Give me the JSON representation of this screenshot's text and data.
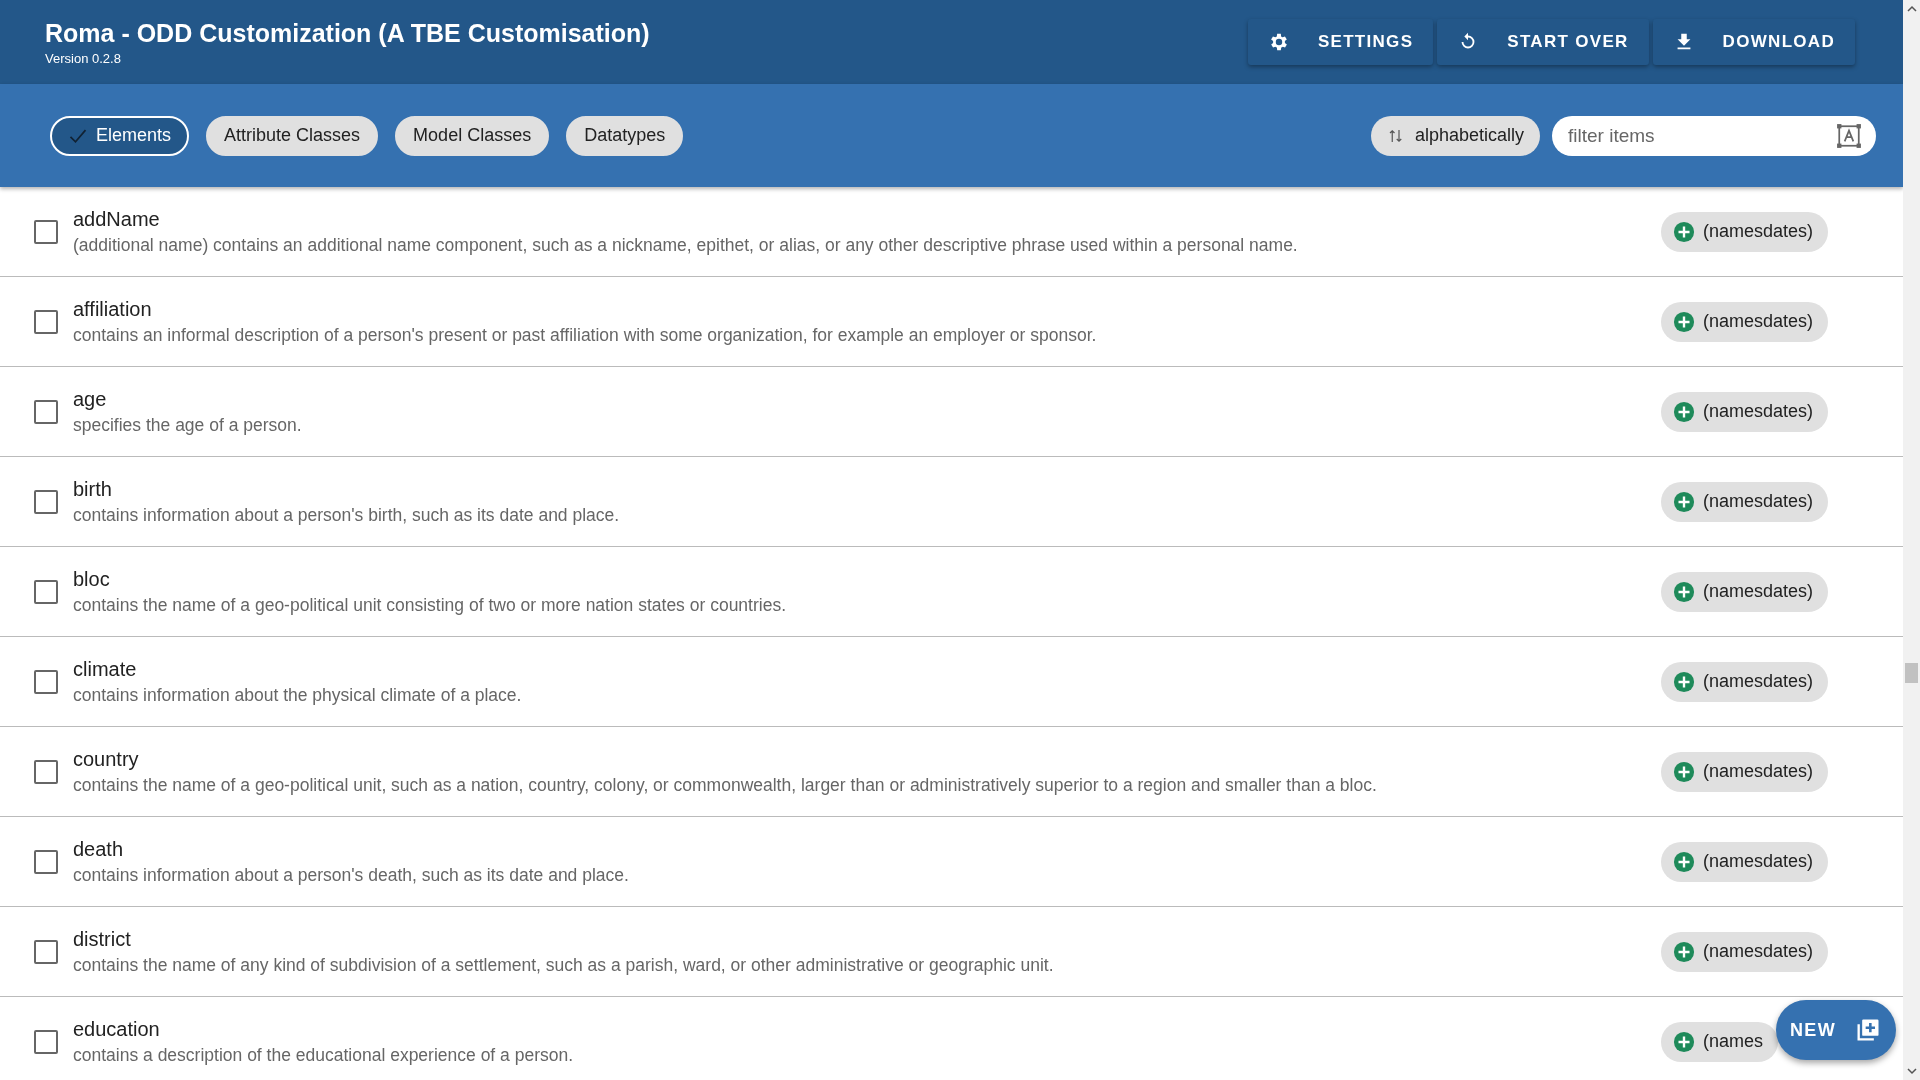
{
  "header": {
    "title": "Roma - ODD Customization (A TBE Customisation)",
    "version": "Version 0.2.8",
    "actions": [
      {
        "kind": "settings",
        "label": "SETTINGS"
      },
      {
        "kind": "reset",
        "label": "START OVER"
      },
      {
        "kind": "download",
        "label": "DOWNLOAD"
      }
    ]
  },
  "filters": [
    {
      "label": "Elements",
      "selected": true
    },
    {
      "label": "Attribute Classes",
      "selected": false
    },
    {
      "label": "Model Classes",
      "selected": false
    },
    {
      "label": "Datatypes",
      "selected": false
    }
  ],
  "sort": {
    "label": "alphabetically"
  },
  "search": {
    "placeholder": "filter items"
  },
  "items": [
    {
      "name": "addName",
      "description": "(additional name) contains an additional name component, such as a nickname, epithet, or alias, or any other descriptive phrase used within a personal name.",
      "checked": false,
      "module": "(namesdates)"
    },
    {
      "name": "affiliation",
      "description": "contains an informal description of a person's present or past affiliation with some organization, for example an employer or sponsor.",
      "checked": false,
      "module": "(namesdates)"
    },
    {
      "name": "age",
      "description": "specifies the age of a person.",
      "checked": false,
      "module": "(namesdates)"
    },
    {
      "name": "birth",
      "description": "contains information about a person's birth, such as its date and place.",
      "checked": false,
      "module": "(namesdates)"
    },
    {
      "name": "bloc",
      "description": "contains the name of a geo-political unit consisting of two or more nation states or countries.",
      "checked": false,
      "module": "(namesdates)"
    },
    {
      "name": "climate",
      "description": "contains information about the physical climate of a place.",
      "checked": false,
      "module": "(namesdates)"
    },
    {
      "name": "country",
      "description": "contains the name of a geo-political unit, such as a nation, country, colony, or commonwealth, larger than or administratively superior to a region and smaller than a bloc.",
      "checked": false,
      "module": "(namesdates)"
    },
    {
      "name": "death",
      "description": "contains information about a person's death, such as its date and place.",
      "checked": false,
      "module": "(namesdates)"
    },
    {
      "name": "district",
      "description": "contains the name of any kind of subdivision of a settlement, such as a parish, ward, or other administrative or geographic unit.",
      "checked": false,
      "module": "(namesdates)"
    },
    {
      "name": "education",
      "description": "contains a description of the educational experience of a person.",
      "checked": false,
      "module": "(names"
    }
  ],
  "fab": {
    "label": "NEW"
  }
}
